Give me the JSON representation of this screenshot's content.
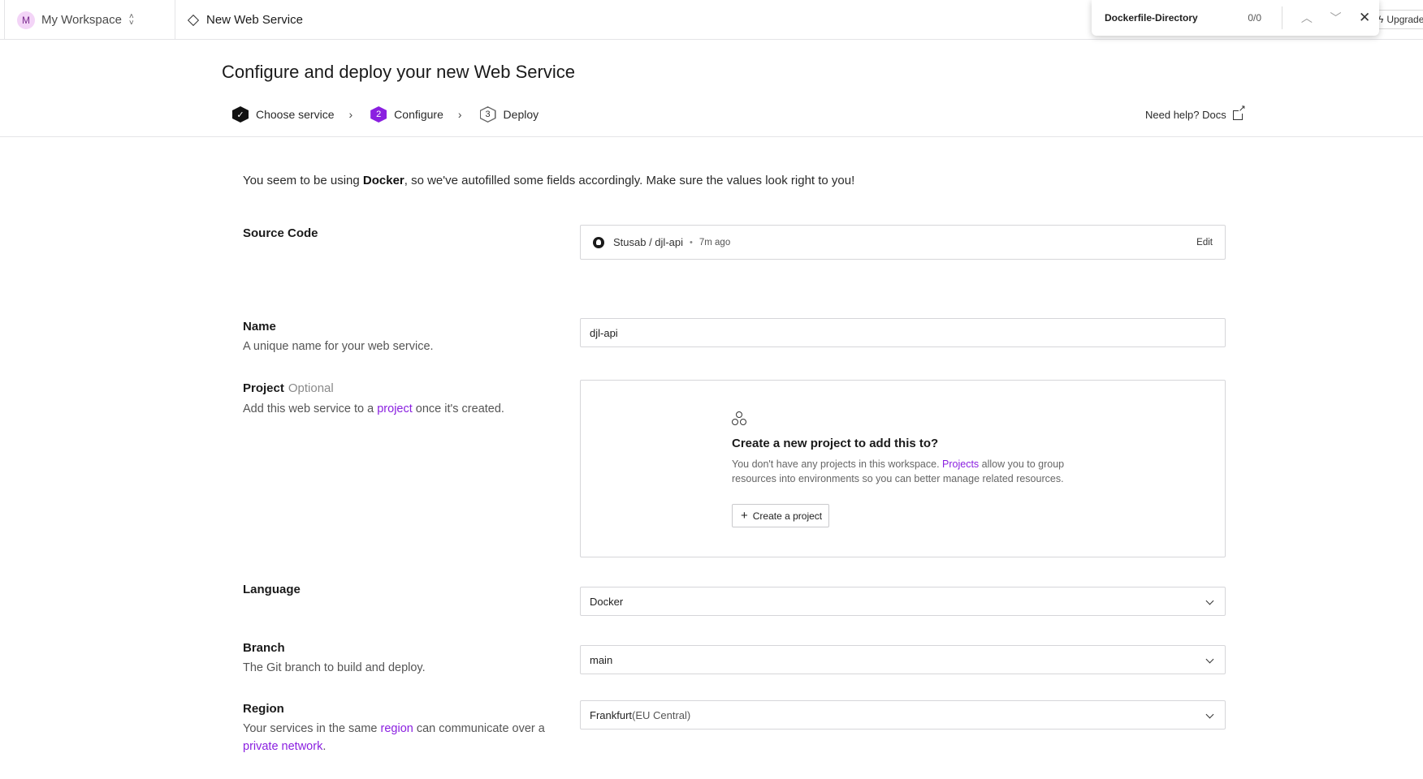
{
  "topbar": {
    "workspace_initial": "M",
    "workspace_name": "My Workspace",
    "breadcrumb": "New Web Service",
    "upgrade_label": "Upgrade"
  },
  "find_bar": {
    "query": "Dockerfile-Directory",
    "count": "0/0"
  },
  "header": {
    "title": "Configure and deploy your new Web Service",
    "steps": [
      {
        "label": "Choose service",
        "badge": "✓"
      },
      {
        "label": "Configure",
        "badge": "2"
      },
      {
        "label": "Deploy",
        "badge": "3"
      }
    ],
    "help_label": "Need help? Docs"
  },
  "notice": {
    "prefix": "You seem to be using ",
    "highlight": "Docker",
    "suffix": ", so we've autofilled some fields accordingly. Make sure the values look right to you!"
  },
  "source_code": {
    "label": "Source Code",
    "repo": "Stusab / djl-api",
    "separator": "•",
    "time": "7m ago",
    "edit_label": "Edit"
  },
  "name_field": {
    "label": "Name",
    "description": "A unique name for your web service.",
    "value": "djl-api"
  },
  "project_field": {
    "label": "Project",
    "optional": "Optional",
    "desc_prefix": "Add this web service to a ",
    "desc_link": "project",
    "desc_suffix": " once it's created.",
    "empty_title": "Create a new project to add this to?",
    "empty_prefix": "You don't have any projects in this workspace. ",
    "empty_link": "Projects",
    "empty_suffix": " allow you to group resources into environments so you can better manage related resources.",
    "create_label": "Create a project"
  },
  "language_field": {
    "label": "Language",
    "value": "Docker"
  },
  "branch_field": {
    "label": "Branch",
    "description": "The Git branch to build and deploy.",
    "value": "main"
  },
  "region_field": {
    "label": "Region",
    "desc_prefix": "Your services in the same ",
    "desc_link1": "region",
    "desc_middle": " can communicate over a",
    "desc_link2": "private network",
    "desc_suffix": ".",
    "value_main": "Frankfurt",
    "value_sub": " (EU Central)"
  },
  "colors": {
    "accent": "#8a1fe0",
    "border": "#d6d6d9"
  }
}
